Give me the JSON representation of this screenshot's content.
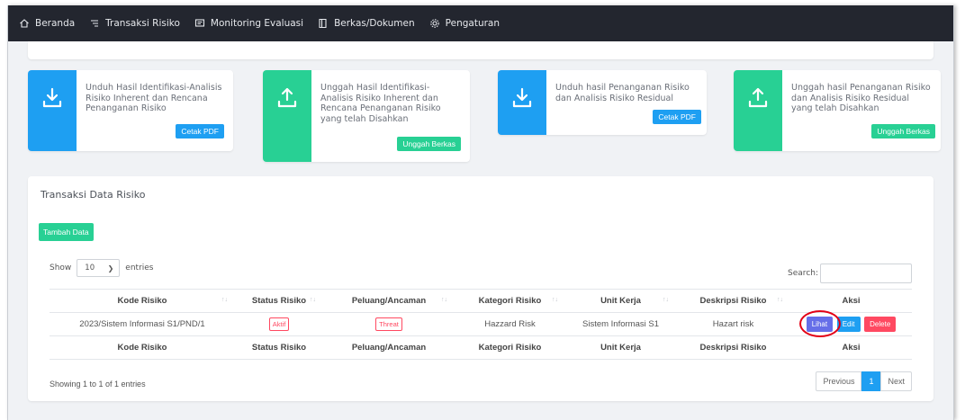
{
  "nav": {
    "items": [
      {
        "label": "Beranda",
        "icon": "home-icon"
      },
      {
        "label": "Transaksi Risiko",
        "icon": "list-icon"
      },
      {
        "label": "Monitoring Evaluasi",
        "icon": "monitor-icon"
      },
      {
        "label": "Berkas/Dokumen",
        "icon": "book-icon"
      },
      {
        "label": "Pengaturan",
        "icon": "gear-icon"
      }
    ]
  },
  "cards": [
    {
      "text": "Unduh Hasil Identifikasi-Analisis Risiko Inherent dan Rencana Penanganan Risiko",
      "button": "Cetak PDF",
      "icon": "download-icon",
      "color": "#1e9ff2"
    },
    {
      "text": "Unggah Hasil Identifikasi-Analisis Risiko Inherent dan Rencana Penanganan Risiko yang telah Disahkan",
      "button": "Unggah Berkas",
      "icon": "upload-icon",
      "color": "#28d094"
    },
    {
      "text": "Unduh hasil Penanganan Risiko dan Analisis Risiko Residual",
      "button": "Cetak PDF",
      "icon": "download-icon",
      "color": "#1e9ff2"
    },
    {
      "text": "Unggah hasil Penanganan Risiko dan Analisis Risiko Residual yang telah Disahkan",
      "button": "Unggah Berkas",
      "icon": "upload-icon",
      "color": "#28d094"
    }
  ],
  "panel": {
    "title": "Transaksi Data Risiko",
    "add_button": "Tambah Data",
    "show_label": "Show",
    "entries_value": "10",
    "entries_label": "entries",
    "search_label": "Search:",
    "search_value": ""
  },
  "table": {
    "columns": [
      "Kode Risiko",
      "Status Risiko",
      "Peluang/Ancaman",
      "Kategori Risiko",
      "Unit Kerja",
      "Deskripsi Risiko",
      "Aksi"
    ],
    "rows": [
      {
        "kode": "2023/Sistem Informasi S1/PND/1",
        "status": "Aktif",
        "peluang": "Threat",
        "kategori": "Hazzard Risk",
        "unit": "Sistem Informasi S1",
        "deskripsi": "Hazart risk",
        "actions": {
          "view": "Lihat",
          "edit": "Edit",
          "delete": "Delete"
        }
      }
    ]
  },
  "footer": {
    "info": "Showing 1 to 1 of 1 entries",
    "previous": "Previous",
    "page": "1",
    "next": "Next"
  }
}
